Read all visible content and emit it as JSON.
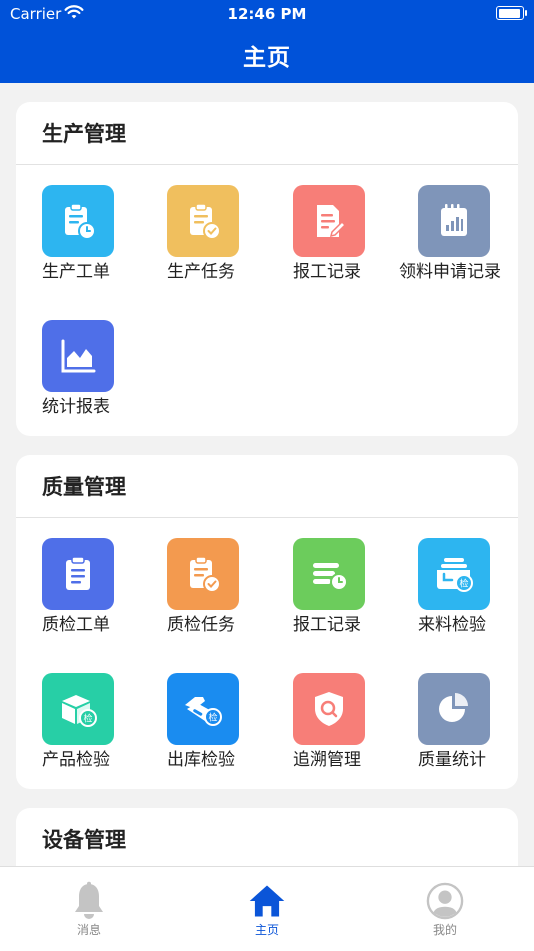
{
  "status_bar": {
    "carrier": "Carrier",
    "time": "12:46 PM"
  },
  "header": {
    "title": "主页"
  },
  "sections": [
    {
      "title": "生产管理",
      "items": [
        {
          "label": "生产工单",
          "icon": "clipboard-clock-icon",
          "color": "#2db5f0"
        },
        {
          "label": "生产任务",
          "icon": "clipboard-check-icon",
          "color": "#f0bf5e"
        },
        {
          "label": "报工记录",
          "icon": "document-edit-icon",
          "color": "#f77e78"
        },
        {
          "label": "领料申请记录",
          "icon": "notepad-chart-icon",
          "color": "#7f95b9"
        },
        {
          "label": "统计报表",
          "icon": "area-chart-icon",
          "color": "#4f6fe8"
        }
      ]
    },
    {
      "title": "质量管理",
      "items": [
        {
          "label": "质检工单",
          "icon": "clipboard-list-icon",
          "color": "#4f6fe8"
        },
        {
          "label": "质检任务",
          "icon": "clipboard-check-icon",
          "color": "#f39a4f"
        },
        {
          "label": "报工记录",
          "icon": "stack-clock-icon",
          "color": "#6ccc5c"
        },
        {
          "label": "来料检验",
          "icon": "incoming-inspect-icon",
          "color": "#2db5f0"
        },
        {
          "label": "产品检验",
          "icon": "box-inspect-icon",
          "color": "#27cfa6"
        },
        {
          "label": "出库检验",
          "icon": "truck-inspect-icon",
          "color": "#1a8cf0"
        },
        {
          "label": "追溯管理",
          "icon": "shield-search-icon",
          "color": "#f77e78"
        },
        {
          "label": "质量统计",
          "icon": "pie-chart-icon",
          "color": "#7f95b9"
        }
      ]
    },
    {
      "title": "设备管理",
      "items": []
    }
  ],
  "tabbar": {
    "active": "主页",
    "tabs": [
      {
        "label": "消息",
        "icon": "bell-icon"
      },
      {
        "label": "主页",
        "icon": "home-icon"
      },
      {
        "label": "我的",
        "icon": "user-avatar-icon"
      }
    ]
  },
  "colors": {
    "primary": "#0052d9",
    "background": "#f2f2f2"
  }
}
